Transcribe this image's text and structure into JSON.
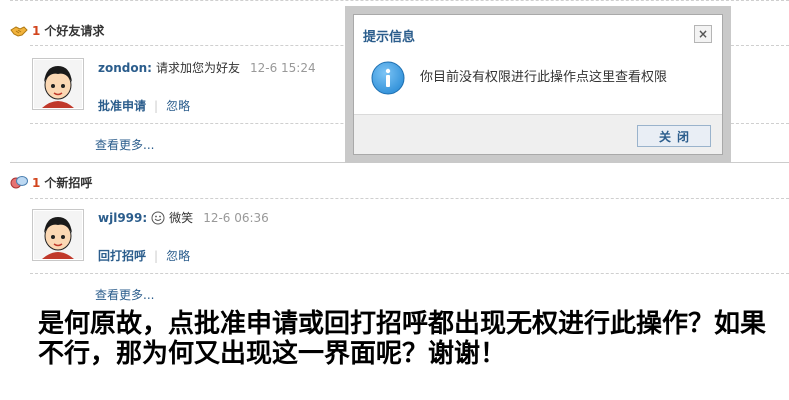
{
  "friend_request_section": {
    "count": "1",
    "title": "个好友请求",
    "item": {
      "username": "zondon:",
      "message": "请求加您为好友",
      "time": "12-6 15:24",
      "primary_action": "批准申请",
      "secondary_action": "忽略"
    },
    "more": "查看更多..."
  },
  "greeting_section": {
    "count": "1",
    "title": "个新招呼",
    "item": {
      "username": "wjl999:",
      "message": "微笑",
      "time": "12-6 06:36",
      "primary_action": "回打招呼",
      "secondary_action": "忽略"
    },
    "more": "查看更多..."
  },
  "dialog": {
    "title": "提示信息",
    "close_symbol": "×",
    "message": "你目前没有权限进行此操作点这里查看权限",
    "button_label": "关闭"
  },
  "question_text": "是何原故，点批准申请或回打招呼都出现无权进行此操作？如果不行，那为何又出现这一界面呢？谢谢！",
  "colors": {
    "link_blue": "#2b5d8c",
    "count_red": "#d2451e",
    "info_icon_blue": "#2f8fd8"
  }
}
